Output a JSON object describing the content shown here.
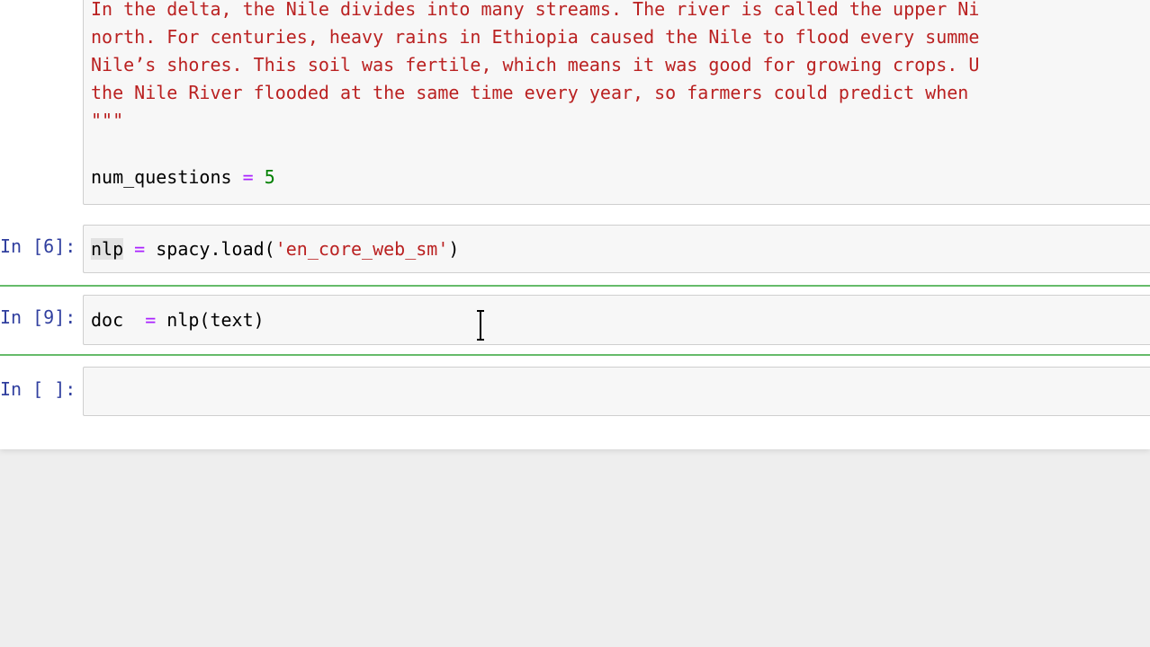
{
  "cell_text": {
    "lines": [
      "In the delta, the Nile divides into many streams. The river is called the upper Ni",
      "north. For centuries, heavy rains in Ethiopia caused the Nile to flood every summe",
      "Nile’s shores. This soil was fertile, which means it was good for growing crops. U",
      "the Nile River flooded at the same time every year, so farmers could predict when",
      "\"\"\""
    ],
    "var": "num_questions",
    "op": "=",
    "value": "5"
  },
  "cells": [
    {
      "prompt": "In [6]:",
      "tokens": [
        {
          "text": "nlp",
          "kind": "hl"
        },
        {
          "text": " ",
          "kind": "plain"
        },
        {
          "text": "=",
          "kind": "op"
        },
        {
          "text": " spacy.load(",
          "kind": "plain"
        },
        {
          "text": "'en_core_web_sm'",
          "kind": "str"
        },
        {
          "text": ")",
          "kind": "plain"
        }
      ]
    },
    {
      "prompt": "In [9]:",
      "tokens": [
        {
          "text": "doc  ",
          "kind": "plain"
        },
        {
          "text": "=",
          "kind": "op"
        },
        {
          "text": " nlp(text)",
          "kind": "plain"
        }
      ]
    },
    {
      "prompt": "In [ ]:",
      "tokens": []
    }
  ]
}
